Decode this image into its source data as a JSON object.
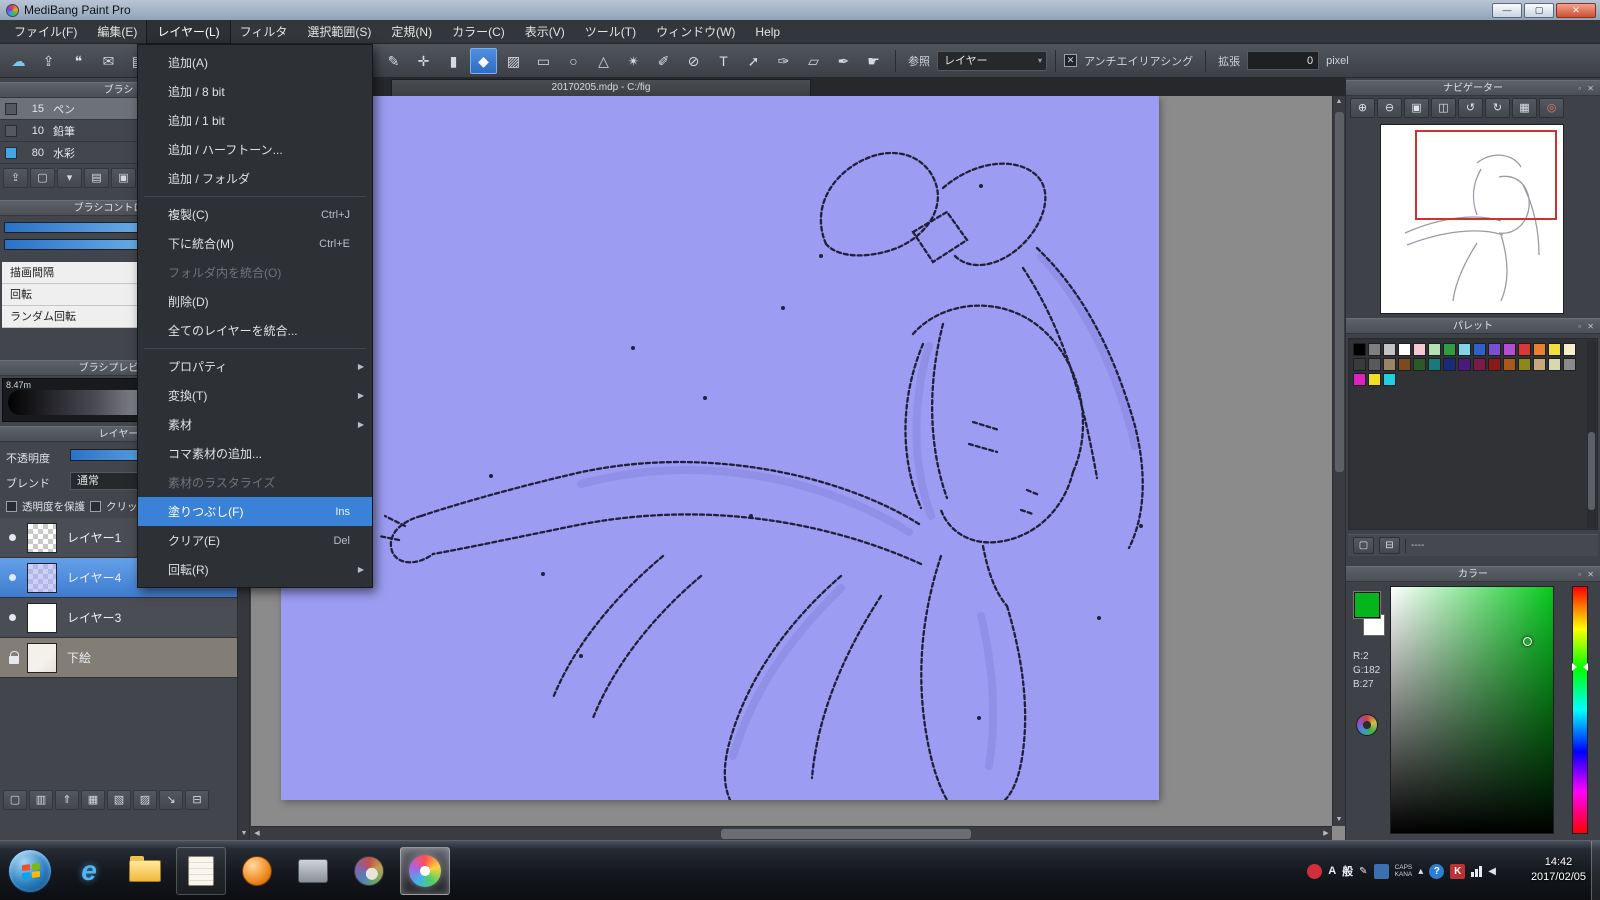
{
  "window": {
    "title": "MediBang Paint Pro",
    "controls": [
      {
        "name": "minimize",
        "glyph": "—"
      },
      {
        "name": "maximize",
        "glyph": "▢"
      },
      {
        "name": "close",
        "glyph": "✕"
      }
    ]
  },
  "menubar": {
    "items": [
      {
        "label": "ファイル(F)"
      },
      {
        "label": "編集(E)"
      },
      {
        "label": "レイヤー(L)",
        "open": true
      },
      {
        "label": "フィルタ"
      },
      {
        "label": "選択範囲(S)"
      },
      {
        "label": "定規(N)"
      },
      {
        "label": "カラー(C)"
      },
      {
        "label": "表示(V)"
      },
      {
        "label": "ツール(T)"
      },
      {
        "label": "ウィンドウ(W)"
      },
      {
        "label": "Help"
      }
    ]
  },
  "layer_menu": {
    "items": [
      {
        "label": "追加(A)"
      },
      {
        "label": "追加 / 8 bit"
      },
      {
        "label": "追加 / 1 bit"
      },
      {
        "label": "追加 / ハーフトーン..."
      },
      {
        "label": "追加 / フォルダ"
      },
      {
        "type": "separator"
      },
      {
        "label": "複製(C)",
        "shortcut": "Ctrl+J"
      },
      {
        "label": "下に統合(M)",
        "shortcut": "Ctrl+E"
      },
      {
        "label": "フォルダ内を統合(O)",
        "disabled": true
      },
      {
        "label": "削除(D)"
      },
      {
        "label": "全てのレイヤーを統合..."
      },
      {
        "type": "separator"
      },
      {
        "label": "プロパティ",
        "submenu": true
      },
      {
        "label": "変換(T)",
        "submenu": true
      },
      {
        "label": "素材",
        "submenu": true
      },
      {
        "label": "コマ素材の追加..."
      },
      {
        "label": "素材のラスタライズ",
        "disabled": true
      },
      {
        "label": "塗りつぶし(F)",
        "shortcut": "Ins",
        "highlighted": true
      },
      {
        "label": "クリア(E)",
        "shortcut": "Del"
      },
      {
        "label": "回転(R)",
        "submenu": true
      }
    ],
    "highlight_color": "#3a81d8"
  },
  "toolbar": {
    "left_tools": [
      {
        "name": "cloud-icon",
        "glyph": "☁",
        "accent": true
      },
      {
        "name": "upload-icon",
        "glyph": "⇪"
      },
      {
        "name": "comment-icon",
        "glyph": "❝"
      },
      {
        "name": "message-icon",
        "glyph": "✉"
      },
      {
        "name": "document-icon",
        "glyph": "▤"
      }
    ],
    "tools": [
      {
        "name": "line-tool",
        "glyph": "✎"
      },
      {
        "name": "move-tool",
        "glyph": "✛"
      },
      {
        "name": "shape-tool",
        "glyph": "▮"
      },
      {
        "name": "bucket-tool",
        "glyph": "◆",
        "active": true
      },
      {
        "name": "gradient-tool",
        "glyph": "▨"
      },
      {
        "name": "select-rect-tool",
        "glyph": "▭"
      },
      {
        "name": "select-ellipse-tool",
        "glyph": "○"
      },
      {
        "name": "select-poly-tool",
        "glyph": "△"
      },
      {
        "name": "magic-wand-tool",
        "glyph": "✴"
      },
      {
        "name": "select-pen-tool",
        "glyph": "✐"
      },
      {
        "name": "select-eraser-tool",
        "glyph": "⊘"
      },
      {
        "name": "text-tool",
        "glyph": "T"
      },
      {
        "name": "operation-tool",
        "glyph": "➚"
      },
      {
        "name": "brush-tool",
        "glyph": "✑"
      },
      {
        "name": "eraser-tool",
        "glyph": "▱"
      },
      {
        "name": "eyedropper-tool",
        "glyph": "✒"
      },
      {
        "name": "hand-tool",
        "glyph": "☛"
      }
    ],
    "reference_label": "参照",
    "reference_value": "レイヤー",
    "antialias_label": "アンチエイリアシング",
    "antialias_checked": true,
    "expand_label": "拡張",
    "expand_value": "0",
    "expand_unit": "pixel"
  },
  "canvas": {
    "tab_title": "20170205.mdp - C:/fig",
    "background": "#9c9cf2"
  },
  "brush_panel": {
    "title": "ブラシ",
    "brushes": [
      {
        "size": "15",
        "name": "ペン",
        "selected": true,
        "swatch": "#55585e"
      },
      {
        "size": "10",
        "name": "鉛筆",
        "swatch": "#55585e"
      },
      {
        "size": "80",
        "name": "水彩",
        "swatch": "#3fa8e8"
      }
    ],
    "toolbar": [
      {
        "name": "brush-up-icon",
        "glyph": "⇪"
      },
      {
        "name": "brush-new-icon",
        "glyph": "▢"
      },
      {
        "name": "brush-menu-icon",
        "glyph": "▾"
      },
      {
        "name": "brush-list-icon",
        "glyph": "▤"
      },
      {
        "name": "brush-folder-icon",
        "glyph": "▣"
      }
    ],
    "control_title": "ブラシコントロール",
    "rows": [
      {
        "label": "描画間隔",
        "dial": true
      },
      {
        "label": "回転"
      },
      {
        "label": "ランダム回転"
      }
    ],
    "preview_title": "ブラシプレビュー",
    "preview_value": "8.47m"
  },
  "layer_panel": {
    "title": "レイヤー",
    "opacity_label": "不透明度",
    "blend_label": "ブレンド",
    "blend_value": "通常",
    "protect_alpha_label": "透明度を保護",
    "clipping_label": "クリッピング",
    "layers": [
      {
        "name": "レイヤー1",
        "visible": true,
        "thumb": "checker"
      },
      {
        "name": "レイヤー4",
        "visible": true,
        "thumb": "checker-blue",
        "selected": true
      },
      {
        "name": "レイヤー3",
        "visible": true,
        "thumb": "white"
      },
      {
        "name": "下絵",
        "locked": true,
        "thumb": "sketch",
        "base": true
      }
    ],
    "buttons": [
      {
        "name": "add-layer-icon",
        "glyph": "▢"
      },
      {
        "name": "duplicate-layer-icon",
        "glyph": "▥"
      },
      {
        "name": "merge-layer-icon",
        "glyph": "⇑"
      },
      {
        "name": "halftone-layer-icon",
        "glyph": "▦"
      },
      {
        "name": "folder-layer-icon",
        "glyph": "▧"
      },
      {
        "name": "material-layer-icon",
        "glyph": "▨"
      },
      {
        "name": "transfer-layer-icon",
        "glyph": "↘"
      },
      {
        "name": "delete-layer-icon",
        "glyph": "⊟"
      }
    ]
  },
  "navigator": {
    "title": "ナビゲーター",
    "buttons": [
      {
        "name": "zoom-in-icon",
        "glyph": "⊕"
      },
      {
        "name": "zoom-out-icon",
        "glyph": "⊖"
      },
      {
        "name": "fit-window-icon",
        "glyph": "▣"
      },
      {
        "name": "actual-size-icon",
        "glyph": "◫"
      },
      {
        "name": "rotate-left-icon",
        "glyph": "↺"
      },
      {
        "name": "rotate-right-icon",
        "glyph": "↻"
      },
      {
        "name": "flip-view-icon",
        "glyph": "▦"
      },
      {
        "name": "reset-view-icon",
        "glyph": "◎",
        "red": true
      }
    ]
  },
  "palette": {
    "title": "パレット",
    "colors": [
      "#000000",
      "#7f7f7f",
      "#c3c3c3",
      "#ffffff",
      "#f7c8d4",
      "#b5e0b0",
      "#2e9e40",
      "#7fd4e8",
      "#2e62c8",
      "#7a4fd0",
      "#b04fd0",
      "#d83838",
      "#e88030",
      "#f0e040",
      "#f6f0c8",
      "#3a3a3a",
      "#5a5a5a",
      "#9a8468",
      "#7a4a20",
      "#2a5a2a",
      "#1a7a7a",
      "#1a2a7a",
      "#4a1a7a",
      "#7a1a4a",
      "#8a1a1a",
      "#a85a1a",
      "#8a8a1a",
      "#c8a878",
      "#d8d8b0",
      "#8a8a8a",
      "#e020c0",
      "#f0e020",
      "#20d0e0"
    ],
    "footer_value": "----"
  },
  "color_panel": {
    "title": "カラー",
    "foreground": "#02b61b",
    "background": "#ffffff",
    "r_label": "R:2",
    "g_label": "G:182",
    "b_label": "B:27"
  },
  "taskbar": {
    "apps": [
      {
        "name": "internet-explorer",
        "kind": "ie",
        "glyph": "e"
      },
      {
        "name": "explorer-folder",
        "kind": "folder"
      },
      {
        "name": "notes-app",
        "kind": "notes",
        "open": true
      },
      {
        "name": "media-player",
        "kind": "orange"
      },
      {
        "name": "device-utility",
        "kind": "gray"
      },
      {
        "name": "paint-app",
        "kind": "palette"
      },
      {
        "name": "medibang-paint",
        "kind": "medibang",
        "active": true
      }
    ],
    "tray": [
      {
        "name": "tray-security-icon",
        "kind": "dot",
        "color": "#d0303a"
      },
      {
        "name": "tray-ime-a-icon",
        "kind": "text",
        "label": "A"
      },
      {
        "name": "tray-ime-mode-icon",
        "kind": "text",
        "label": "般"
      },
      {
        "name": "tray-ime-pen-icon",
        "kind": "glyph",
        "label": "✎"
      },
      {
        "name": "tray-ime-pad-icon",
        "kind": "sq",
        "color": "#3a6fb0"
      },
      {
        "name": "tray-caps-kana",
        "kind": "stack",
        "top": "CAPS",
        "bottom": "KANA"
      },
      {
        "name": "tray-expand-icon",
        "kind": "glyph",
        "label": "▴"
      },
      {
        "name": "tray-help-icon",
        "kind": "dot",
        "color": "#2a7fd0",
        "label": "?"
      },
      {
        "name": "tray-antivirus-icon",
        "kind": "sq",
        "color": "#c03030",
        "label": "K"
      },
      {
        "name": "tray-network-icon",
        "kind": "bars"
      },
      {
        "name": "tray-volume-icon",
        "kind": "glyph",
        "label": "◀"
      }
    ],
    "time": "14:42",
    "date": "2017/02/05"
  }
}
